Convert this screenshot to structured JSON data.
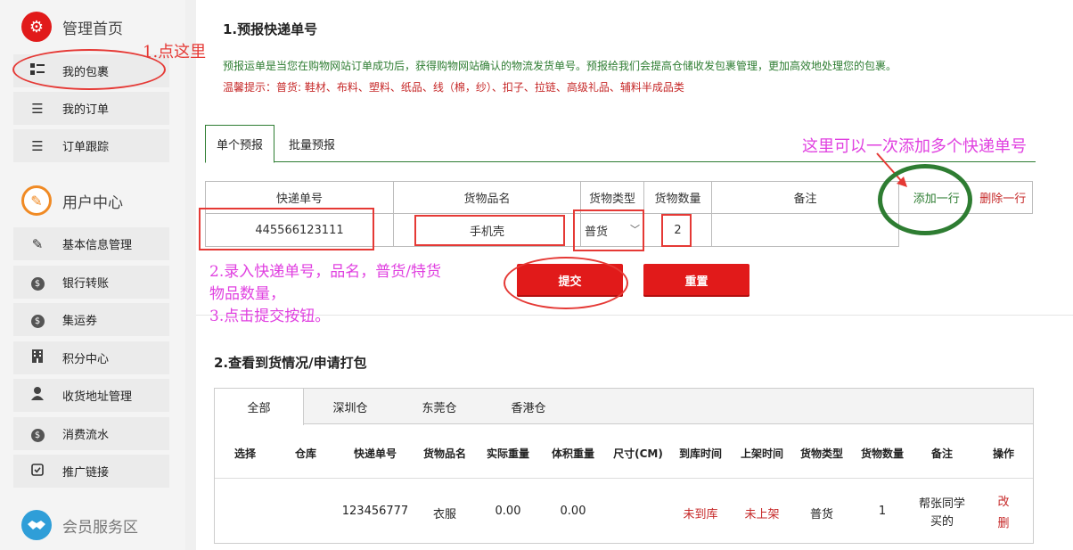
{
  "sidebar": {
    "home_label": "管理首页",
    "user_center_label": "用户中心",
    "member_service_label": "会员服务区",
    "items_top": [
      {
        "label": "我的包裹",
        "icon": "grid-list-icon"
      },
      {
        "label": "我的订单",
        "icon": "list-icon"
      },
      {
        "label": "订单跟踪",
        "icon": "list-icon"
      }
    ],
    "items_user": [
      {
        "label": "基本信息管理",
        "icon": "edit-icon"
      },
      {
        "label": "银行转账",
        "icon": "dollar-icon"
      },
      {
        "label": "集运券",
        "icon": "dollar-icon"
      },
      {
        "label": "积分中心",
        "icon": "building-icon"
      },
      {
        "label": "收货地址管理",
        "icon": "person-icon"
      },
      {
        "label": "消费流水",
        "icon": "dollar-icon"
      },
      {
        "label": "推广链接",
        "icon": "check-square-icon"
      }
    ]
  },
  "section1": {
    "title": "1.预报快递单号",
    "info": "预报运单是当您在购物网站订单成功后，获得购物网站确认的物流发货单号。预报给我们会提高仓储收发包裹管理，更加高效地处理您的包裹。",
    "warning": "温馨提示：普货: 鞋材、布料、塑料、纸品、线（棉，纱）、扣子、拉链、高级礼品、辅料半成品类",
    "tabs": [
      "单个预报",
      "批量预报"
    ],
    "table": {
      "headers": [
        "快递单号",
        "货物品名",
        "货物类型",
        "货物数量",
        "备注"
      ],
      "tracking_no": "445566123111",
      "product": "手机壳",
      "type_selected": "普货",
      "quantity": "2",
      "remark": "",
      "add_row": "添加一行",
      "delete_row": "删除一行"
    },
    "submit_label": "提交",
    "reset_label": "重置"
  },
  "section2": {
    "title": "2.查看到货情况/申请打包",
    "tabs": [
      "全部",
      "深圳仓",
      "东莞仓",
      "香港仓"
    ],
    "columns": [
      "选择",
      "仓库",
      "快递单号",
      "货物品名",
      "实际重量",
      "体积重量",
      "尺寸(CM)",
      "到库时间",
      "上架时间",
      "货物类型",
      "货物数量",
      "备注",
      "操作"
    ],
    "row": {
      "tracking_no": "123456777",
      "product": "衣服",
      "actual_weight": "0.00",
      "volume_weight": "0.00",
      "arrival": "未到库",
      "shelved": "未上架",
      "type": "普货",
      "quantity": "1",
      "remark": "帮张同学买的",
      "edit": "改",
      "delete": "删"
    }
  },
  "annotations": {
    "step1": "1.点这里",
    "step2_line1": "2.录入快递单号，品名，普货/特货",
    "step2_line2": "物品数量，",
    "step3": "3.点击提交按钮。",
    "multi": "这里可以一次添加多个快递单号"
  },
  "colors": {
    "accent_red": "#e11a1a",
    "info_green": "#2e7d32",
    "warning_red": "#c62828",
    "annotation_magenta": "#e040e0",
    "annotation_red": "#e53935",
    "circle_green": "#2e7d32"
  }
}
